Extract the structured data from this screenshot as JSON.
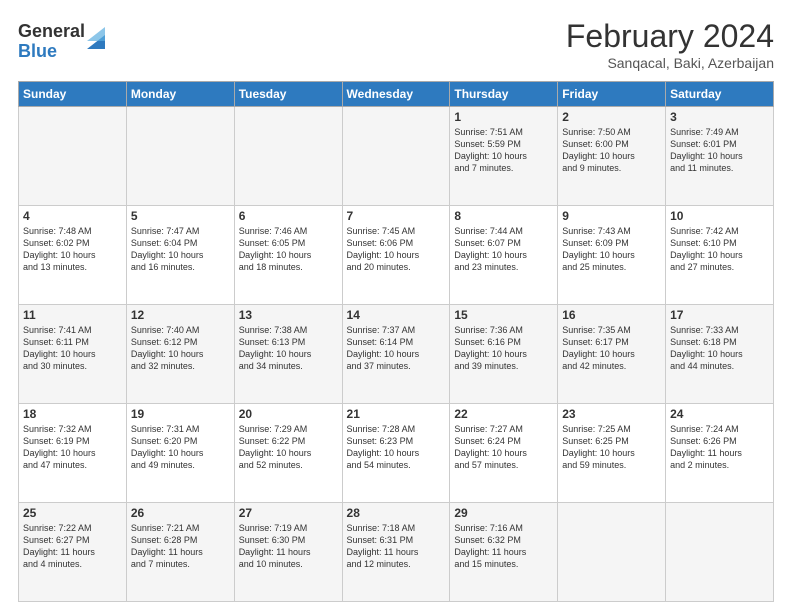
{
  "logo": {
    "general": "General",
    "blue": "Blue"
  },
  "header": {
    "title": "February 2024",
    "subtitle": "Sanqacal, Baki, Azerbaijan"
  },
  "days_of_week": [
    "Sunday",
    "Monday",
    "Tuesday",
    "Wednesday",
    "Thursday",
    "Friday",
    "Saturday"
  ],
  "weeks": [
    [
      {
        "day": "",
        "info": ""
      },
      {
        "day": "",
        "info": ""
      },
      {
        "day": "",
        "info": ""
      },
      {
        "day": "",
        "info": ""
      },
      {
        "day": "1",
        "info": "Sunrise: 7:51 AM\nSunset: 5:59 PM\nDaylight: 10 hours\nand 7 minutes."
      },
      {
        "day": "2",
        "info": "Sunrise: 7:50 AM\nSunset: 6:00 PM\nDaylight: 10 hours\nand 9 minutes."
      },
      {
        "day": "3",
        "info": "Sunrise: 7:49 AM\nSunset: 6:01 PM\nDaylight: 10 hours\nand 11 minutes."
      }
    ],
    [
      {
        "day": "4",
        "info": "Sunrise: 7:48 AM\nSunset: 6:02 PM\nDaylight: 10 hours\nand 13 minutes."
      },
      {
        "day": "5",
        "info": "Sunrise: 7:47 AM\nSunset: 6:04 PM\nDaylight: 10 hours\nand 16 minutes."
      },
      {
        "day": "6",
        "info": "Sunrise: 7:46 AM\nSunset: 6:05 PM\nDaylight: 10 hours\nand 18 minutes."
      },
      {
        "day": "7",
        "info": "Sunrise: 7:45 AM\nSunset: 6:06 PM\nDaylight: 10 hours\nand 20 minutes."
      },
      {
        "day": "8",
        "info": "Sunrise: 7:44 AM\nSunset: 6:07 PM\nDaylight: 10 hours\nand 23 minutes."
      },
      {
        "day": "9",
        "info": "Sunrise: 7:43 AM\nSunset: 6:09 PM\nDaylight: 10 hours\nand 25 minutes."
      },
      {
        "day": "10",
        "info": "Sunrise: 7:42 AM\nSunset: 6:10 PM\nDaylight: 10 hours\nand 27 minutes."
      }
    ],
    [
      {
        "day": "11",
        "info": "Sunrise: 7:41 AM\nSunset: 6:11 PM\nDaylight: 10 hours\nand 30 minutes."
      },
      {
        "day": "12",
        "info": "Sunrise: 7:40 AM\nSunset: 6:12 PM\nDaylight: 10 hours\nand 32 minutes."
      },
      {
        "day": "13",
        "info": "Sunrise: 7:38 AM\nSunset: 6:13 PM\nDaylight: 10 hours\nand 34 minutes."
      },
      {
        "day": "14",
        "info": "Sunrise: 7:37 AM\nSunset: 6:14 PM\nDaylight: 10 hours\nand 37 minutes."
      },
      {
        "day": "15",
        "info": "Sunrise: 7:36 AM\nSunset: 6:16 PM\nDaylight: 10 hours\nand 39 minutes."
      },
      {
        "day": "16",
        "info": "Sunrise: 7:35 AM\nSunset: 6:17 PM\nDaylight: 10 hours\nand 42 minutes."
      },
      {
        "day": "17",
        "info": "Sunrise: 7:33 AM\nSunset: 6:18 PM\nDaylight: 10 hours\nand 44 minutes."
      }
    ],
    [
      {
        "day": "18",
        "info": "Sunrise: 7:32 AM\nSunset: 6:19 PM\nDaylight: 10 hours\nand 47 minutes."
      },
      {
        "day": "19",
        "info": "Sunrise: 7:31 AM\nSunset: 6:20 PM\nDaylight: 10 hours\nand 49 minutes."
      },
      {
        "day": "20",
        "info": "Sunrise: 7:29 AM\nSunset: 6:22 PM\nDaylight: 10 hours\nand 52 minutes."
      },
      {
        "day": "21",
        "info": "Sunrise: 7:28 AM\nSunset: 6:23 PM\nDaylight: 10 hours\nand 54 minutes."
      },
      {
        "day": "22",
        "info": "Sunrise: 7:27 AM\nSunset: 6:24 PM\nDaylight: 10 hours\nand 57 minutes."
      },
      {
        "day": "23",
        "info": "Sunrise: 7:25 AM\nSunset: 6:25 PM\nDaylight: 10 hours\nand 59 minutes."
      },
      {
        "day": "24",
        "info": "Sunrise: 7:24 AM\nSunset: 6:26 PM\nDaylight: 11 hours\nand 2 minutes."
      }
    ],
    [
      {
        "day": "25",
        "info": "Sunrise: 7:22 AM\nSunset: 6:27 PM\nDaylight: 11 hours\nand 4 minutes."
      },
      {
        "day": "26",
        "info": "Sunrise: 7:21 AM\nSunset: 6:28 PM\nDaylight: 11 hours\nand 7 minutes."
      },
      {
        "day": "27",
        "info": "Sunrise: 7:19 AM\nSunset: 6:30 PM\nDaylight: 11 hours\nand 10 minutes."
      },
      {
        "day": "28",
        "info": "Sunrise: 7:18 AM\nSunset: 6:31 PM\nDaylight: 11 hours\nand 12 minutes."
      },
      {
        "day": "29",
        "info": "Sunrise: 7:16 AM\nSunset: 6:32 PM\nDaylight: 11 hours\nand 15 minutes."
      },
      {
        "day": "",
        "info": ""
      },
      {
        "day": "",
        "info": ""
      }
    ]
  ]
}
